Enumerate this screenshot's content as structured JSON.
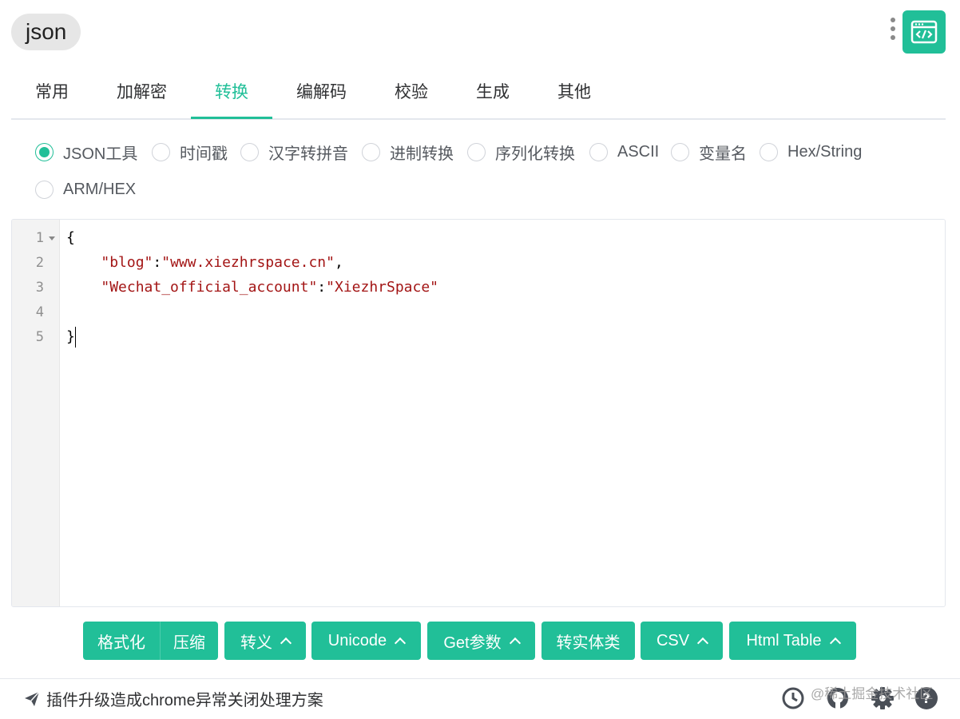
{
  "header": {
    "title": "json",
    "menu_icon": "kebab-menu-icon",
    "logo_icon": "code-window-icon",
    "accent_color": "#21bf98"
  },
  "tabs": [
    {
      "label": "常用",
      "active": false
    },
    {
      "label": "加解密",
      "active": false
    },
    {
      "label": "转换",
      "active": true
    },
    {
      "label": "编解码",
      "active": false
    },
    {
      "label": "校验",
      "active": false
    },
    {
      "label": "生成",
      "active": false
    },
    {
      "label": "其他",
      "active": false
    }
  ],
  "radios": [
    {
      "label": "JSON工具",
      "checked": true
    },
    {
      "label": "时间戳",
      "checked": false
    },
    {
      "label": "汉字转拼音",
      "checked": false
    },
    {
      "label": "进制转换",
      "checked": false
    },
    {
      "label": "序列化转换",
      "checked": false
    },
    {
      "label": "ASCII",
      "checked": false
    },
    {
      "label": "变量名",
      "checked": false
    },
    {
      "label": "Hex/String",
      "checked": false
    },
    {
      "label": "ARM/HEX",
      "checked": false
    }
  ],
  "editor": {
    "line_numbers": [
      "1",
      "2",
      "3",
      "4",
      "5"
    ],
    "lines": [
      {
        "open_brace": "{"
      },
      {
        "indent": "    ",
        "key": "\"blog\"",
        "colon": ":",
        "value": "\"www.xiezhrspace.cn\"",
        "comma": ","
      },
      {
        "indent": "    ",
        "key": "\"Wechat_official_account\"",
        "colon": ":",
        "value": "\"XiezhrSpace\""
      },
      {},
      {
        "close_brace": "}"
      }
    ]
  },
  "buttons": {
    "format": "格式化",
    "compress": "压缩",
    "escape": "转义",
    "unicode": "Unicode",
    "get_params": "Get参数",
    "to_entity": "转实体类",
    "csv": "CSV",
    "html_table": "Html Table"
  },
  "footer": {
    "notice_icon": "paper-plane-icon",
    "notice_text": "插件升级造成chrome异常关闭处理方案",
    "history_icon": "clock-icon",
    "github_icon": "github-icon",
    "settings_icon": "gear-icon",
    "help_icon": "help-icon",
    "watermark": "@稀土掘金技术社区"
  }
}
